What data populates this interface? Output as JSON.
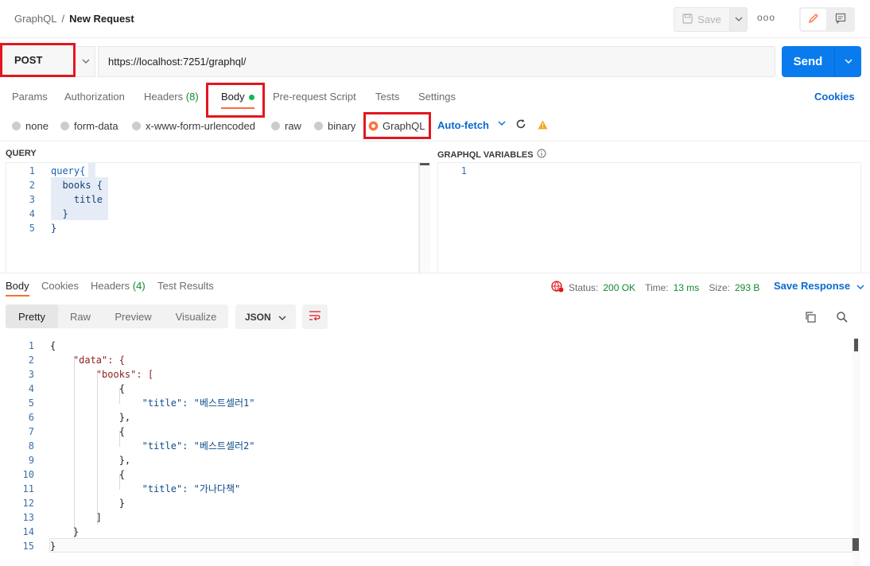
{
  "header": {
    "breadcrumb_root": "GraphQL",
    "breadcrumb_sep": "/",
    "breadcrumb_current": "New Request",
    "save_label": "Save",
    "more_label": "ooo"
  },
  "request": {
    "method": "POST",
    "url": "https://localhost:7251/graphql/",
    "send_label": "Send"
  },
  "req_tabs": {
    "params": "Params",
    "authorization": "Authorization",
    "headers": "Headers",
    "headers_count": "(8)",
    "body": "Body",
    "prerequest": "Pre-request Script",
    "tests": "Tests",
    "settings": "Settings",
    "cookies": "Cookies"
  },
  "body_types": {
    "none": "none",
    "form_data": "form-data",
    "urlencoded": "x-www-form-urlencoded",
    "raw": "raw",
    "binary": "binary",
    "graphql": "GraphQL",
    "autofetch": "Auto-fetch"
  },
  "editors": {
    "query_label": "QUERY",
    "vars_label": "GRAPHQL VARIABLES",
    "query_lines": [
      "query{",
      "  books {",
      "    title",
      "  }",
      "}"
    ],
    "vars_lines": [
      ""
    ]
  },
  "response": {
    "tab_body": "Body",
    "tab_cookies": "Cookies",
    "tab_headers": "Headers",
    "headers_count": "(4)",
    "tab_tests": "Test Results",
    "status_label": "Status:",
    "status_value": "200 OK",
    "time_label": "Time:",
    "time_value": "13 ms",
    "size_label": "Size:",
    "size_value": "293 B",
    "save_response": "Save Response",
    "view_pretty": "Pretty",
    "view_raw": "Raw",
    "view_preview": "Preview",
    "view_visualize": "Visualize",
    "format": "JSON",
    "json_lines": [
      "{",
      "    \"data\": {",
      "        \"books\": [",
      "            {",
      "                \"title\": \"베스트셀러1\"",
      "            },",
      "            {",
      "                \"title\": \"베스트셀러2\"",
      "            },",
      "            {",
      "                \"title\": \"가나다책\"",
      "            }",
      "        ]",
      "    }",
      "}"
    ]
  },
  "colors": {
    "accent": "#ff6c37",
    "send": "#097bed",
    "link": "#0a6ad0",
    "ok": "#0e8b2f",
    "annotation": "#e3161f"
  }
}
